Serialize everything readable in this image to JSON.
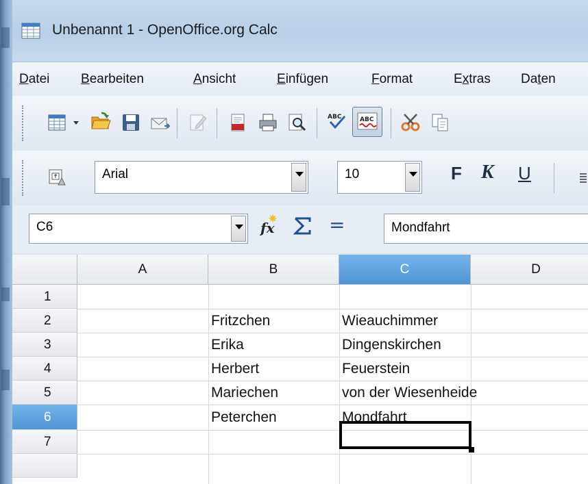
{
  "window": {
    "title": "Unbenannt 1 - OpenOffice.org Calc"
  },
  "menu": [
    {
      "pre": "",
      "u": "D",
      "post": "atei"
    },
    {
      "pre": "",
      "u": "B",
      "post": "earbeiten"
    },
    {
      "pre": "",
      "u": "A",
      "post": "nsicht"
    },
    {
      "pre": "",
      "u": "E",
      "post": "infügen"
    },
    {
      "pre": "",
      "u": "F",
      "post": "ormat"
    },
    {
      "pre": "E",
      "u": "x",
      "post": "tras"
    },
    {
      "pre": "Da",
      "u": "t",
      "post": "en"
    }
  ],
  "formatting": {
    "font_name": "Arial",
    "font_size": "10",
    "bold_label": "F",
    "italic_label": "K",
    "underline_label": "U"
  },
  "formula_bar": {
    "name_box": "C6",
    "equals_label": "=",
    "content": "Mondfahrt"
  },
  "sheet": {
    "columns": [
      "A",
      "B",
      "C",
      "D"
    ],
    "selected_column": "C",
    "rows": [
      "1",
      "2",
      "3",
      "4",
      "5",
      "6",
      "7"
    ],
    "selected_row": "6",
    "cells": {
      "B2": "Fritzchen",
      "C2": "Wieauchimmer",
      "B3": "Erika",
      "C3": "Dingenskirchen",
      "B4": "Herbert",
      "C4": "Feuerstein",
      "B5": "Mariechen",
      "C5": "von der Wiesenheide",
      "B6": "Peterchen",
      "C6": "Mondfahrt"
    }
  },
  "colors": {
    "selection_header": "#5aa2df",
    "title_bar": "#bfd3e9"
  }
}
